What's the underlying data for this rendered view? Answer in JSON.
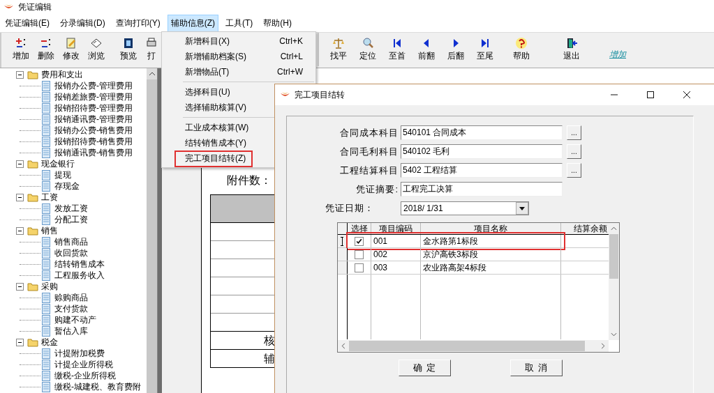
{
  "window": {
    "title": "凭证编辑"
  },
  "menu_bar": [
    {
      "label": "凭证编辑(E)",
      "selected": false
    },
    {
      "label": "分录编辑(D)",
      "selected": false
    },
    {
      "label": "查询打印(Y)",
      "selected": false
    },
    {
      "label": "辅助信息(Z)",
      "selected": true
    },
    {
      "label": "工具(T)",
      "selected": false
    },
    {
      "label": "帮助(H)",
      "selected": false
    }
  ],
  "toolbar_left": [
    {
      "label": "增加"
    },
    {
      "label": "删除"
    },
    {
      "label": "修改"
    },
    {
      "label": "浏览"
    },
    {
      "label": "预览"
    },
    {
      "label": "打"
    }
  ],
  "toolbar_right": [
    {
      "label": "找平"
    },
    {
      "label": "定位"
    },
    {
      "label": "至首"
    },
    {
      "label": "前翻"
    },
    {
      "label": "后翻"
    },
    {
      "label": "至尾"
    },
    {
      "label": "帮助"
    },
    {
      "label": "退出"
    }
  ],
  "toolbar_link": "增加",
  "tree": [
    {
      "label": "费用和支出",
      "expanded": true,
      "children": [
        {
          "label": "报销办公费-管理费用"
        },
        {
          "label": "报销差旅费-管理费用"
        },
        {
          "label": "报销招待费-管理费用"
        },
        {
          "label": "报销通讯费-管理费用"
        },
        {
          "label": "报销办公费-销售费用"
        },
        {
          "label": "报销招待费-销售费用"
        },
        {
          "label": "报销通讯费-销售费用"
        }
      ]
    },
    {
      "label": "现金银行",
      "expanded": true,
      "children": [
        {
          "label": "提现"
        },
        {
          "label": "存现金"
        }
      ]
    },
    {
      "label": "工资",
      "expanded": true,
      "children": [
        {
          "label": "发放工资"
        },
        {
          "label": "分配工资"
        }
      ]
    },
    {
      "label": "销售",
      "expanded": true,
      "children": [
        {
          "label": "销售商品"
        },
        {
          "label": "收回货款"
        },
        {
          "label": "结转销售成本"
        },
        {
          "label": "工程服务收入"
        }
      ]
    },
    {
      "label": "采购",
      "expanded": true,
      "children": [
        {
          "label": "赊购商品"
        },
        {
          "label": "支付货款"
        },
        {
          "label": "购建不动产"
        },
        {
          "label": "暂估入库"
        }
      ]
    },
    {
      "label": "税金",
      "expanded": true,
      "children": [
        {
          "label": "计提附加税费"
        },
        {
          "label": "计提企业所得税"
        },
        {
          "label": "缴税-企业所得税"
        },
        {
          "label": "缴税-城建税、教育费附"
        }
      ]
    }
  ],
  "voucher": {
    "attachments_label": "附件数：",
    "row_cells": [
      "",
      "",
      "",
      "",
      "",
      "",
      "核",
      "辅"
    ]
  },
  "dropdown": {
    "groups": [
      {
        "items": [
          {
            "label": "新增科目(X)",
            "shortcut": "Ctrl+K",
            "marked": false
          },
          {
            "label": "新增辅助档案(S)",
            "shortcut": "Ctrl+L",
            "marked": false
          },
          {
            "label": "新增物品(T)",
            "shortcut": "Ctrl+W",
            "marked": false
          }
        ]
      },
      {
        "items": [
          {
            "label": "选择科目(U)",
            "marked": false
          },
          {
            "label": "选择辅助核算(V)",
            "marked": false
          }
        ]
      },
      {
        "items": [
          {
            "label": "工业成本核算(W)",
            "marked": false
          },
          {
            "label": "结转销售成本(Y)",
            "marked": false
          },
          {
            "label": "完工项目结转(Z)",
            "marked": true
          }
        ]
      }
    ]
  },
  "dialog": {
    "title": "完工项目结转",
    "fields": [
      {
        "kind": "lookup",
        "label": "合同成本科目",
        "value": "540101 合同成本",
        "button": "..."
      },
      {
        "kind": "lookup",
        "label": "合同毛利科目",
        "value": "540102 毛利",
        "button": "..."
      },
      {
        "kind": "lookup",
        "label": "工程结算科目",
        "value": "5402 工程结算",
        "button": "..."
      },
      {
        "kind": "text",
        "label": "凭证摘要:",
        "value": "工程完工决算"
      },
      {
        "kind": "date",
        "label": "凭证日期：",
        "value": "2018/ 1/31"
      }
    ],
    "table": {
      "columns": [
        "选择",
        "项目编码",
        "项目名称",
        "结算余额"
      ],
      "rows": [
        {
          "current": true,
          "checked": true,
          "code": "001",
          "name": "金水路第1标段",
          "marked": true
        },
        {
          "current": false,
          "checked": false,
          "code": "002",
          "name": "京沪高铁3标段",
          "marked": false
        },
        {
          "current": false,
          "checked": false,
          "code": "003",
          "name": "农业路高架4标段",
          "marked": false
        }
      ]
    },
    "buttons": [
      "确 定",
      "取 消"
    ]
  }
}
